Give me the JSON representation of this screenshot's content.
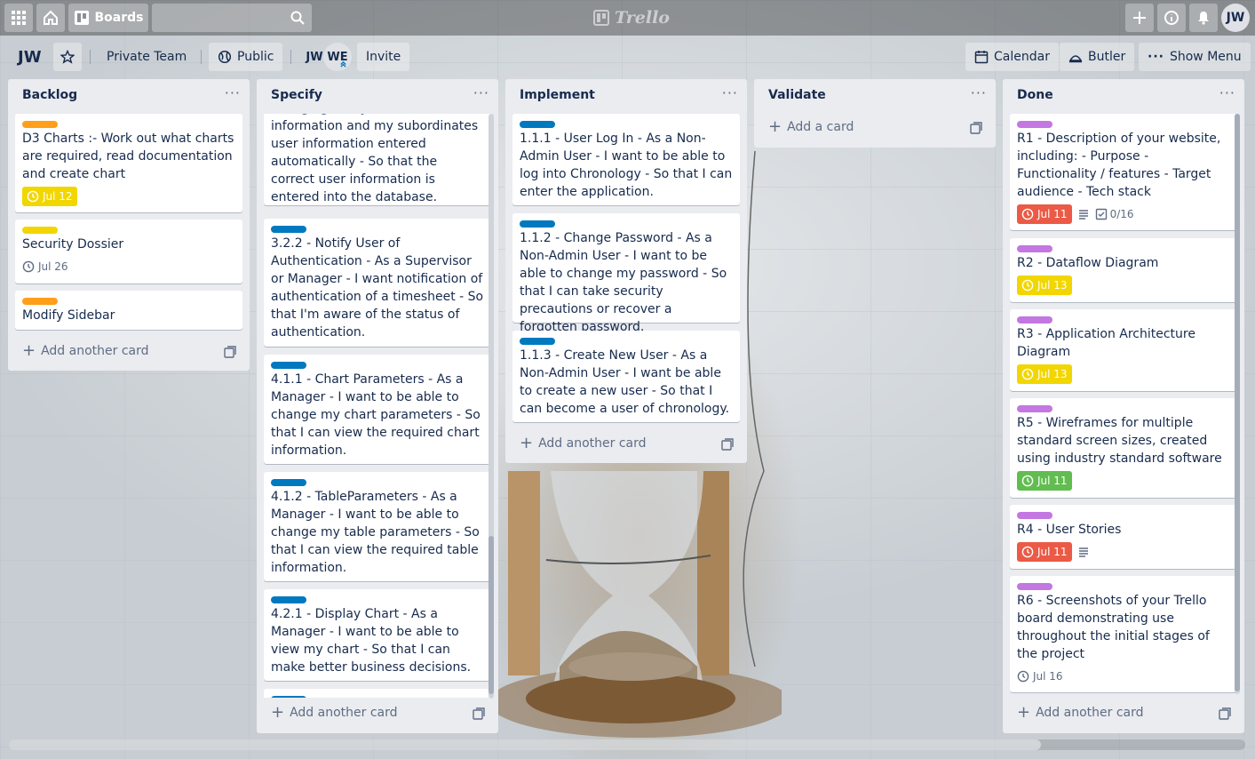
{
  "topbar": {
    "boards_label": "Boards",
    "logo_text": "Trello",
    "avatar_initials": "JW"
  },
  "board_header": {
    "board_name": "JW",
    "team_label": "Private Team",
    "visibility_label": "Public",
    "members": [
      "JW",
      "WE"
    ],
    "invite_label": "Invite",
    "calendar_label": "Calendar",
    "butler_label": "Butler",
    "show_menu_label": "Show Menu"
  },
  "colors": {
    "orange": "#ff9f1a",
    "yellow": "#f2d600",
    "blue": "#0079bf",
    "purple": "#c377e0",
    "due_red": "#eb5a46",
    "due_yellow": "#f2d600",
    "due_green": "#61bd4f"
  },
  "lists": [
    {
      "title": "Backlog",
      "add_label": "Add another card",
      "cards": [
        {
          "text": "D3 Charts :- Work out what charts are required, read documentation and create chart",
          "label": "orange",
          "due": "Jul 12",
          "due_style": "yellow"
        },
        {
          "text": "Security Dossier",
          "label": "yellow",
          "due": "Jul 26",
          "due_style": "plain"
        },
        {
          "text": "Modify Sidebar",
          "label": "orange"
        }
      ]
    },
    {
      "title": "Specify",
      "add_label": "Add another card",
      "cards": [
        {
          "text": "information and my subordinates user information entered automatically - So that the correct user information is entered into the database."
        },
        {
          "text": "3.2.2 - Notify User of Authentication - As a Supervisor or Manager - I want notification of authentication of a timesheet - So that I'm aware of the status of authentication.",
          "label": "blue"
        },
        {
          "text": "4.1.1 - Chart Parameters - As a Manager - I want to be able to change my chart parameters - So that I can view the required chart information.",
          "label": "blue"
        },
        {
          "text": "4.1.2 - TableParameters - As a Manager - I want to be able to change my table parameters - So that I can view the required table information.",
          "label": "blue"
        },
        {
          "text": "4.2.1 - Display Chart - As a Manager - I want to be able to view my chart - So that I can make better business decisions.",
          "label": "blue"
        }
      ]
    },
    {
      "title": "Implement",
      "add_label": "Add another card",
      "cards": [
        {
          "text": "1.1.1 - User Log In - As a Non-Admin User - I want to be able to log into Chronology - So that I can enter the application.",
          "label": "blue"
        },
        {
          "text": "1.1.2 - Change Password - As a Non-Admin User - I want to be able to change my password - So that I can take security precautions or recover a forgotten password.",
          "label": "blue"
        },
        {
          "text": "1.1.3 - Create New User - As a Non-Admin User - I want be able to create a new user - So that I can become a user of chronology.",
          "label": "blue"
        }
      ]
    },
    {
      "title": "Validate",
      "add_label": "Add a card",
      "cards": []
    },
    {
      "title": "Done",
      "add_label": "Add another card",
      "cards": [
        {
          "text": "R1 - Description of your website, including: - Purpose - Functionality / features - Target audience - Tech stack",
          "label": "purple",
          "due": "Jul 11",
          "due_style": "red",
          "has_description": true,
          "checklist": "0/16"
        },
        {
          "text": "R2 - Dataflow Diagram",
          "label": "purple",
          "due": "Jul 13",
          "due_style": "yellow"
        },
        {
          "text": "R3 - Application Architecture Diagram",
          "label": "purple",
          "due": "Jul 13",
          "due_style": "yellow"
        },
        {
          "text": "R5 - Wireframes for multiple standard screen sizes, created using industry standard software",
          "label": "purple",
          "due": "Jul 11",
          "due_style": "green"
        },
        {
          "text": "R4 - User Stories",
          "label": "purple",
          "due": "Jul 11",
          "due_style": "red",
          "has_description": true
        },
        {
          "text": "R6 - Screenshots of your Trello board demonstrating use throughout the initial stages of the project",
          "label": "purple",
          "due": "Jul 16",
          "due_style": "plain"
        }
      ]
    }
  ]
}
